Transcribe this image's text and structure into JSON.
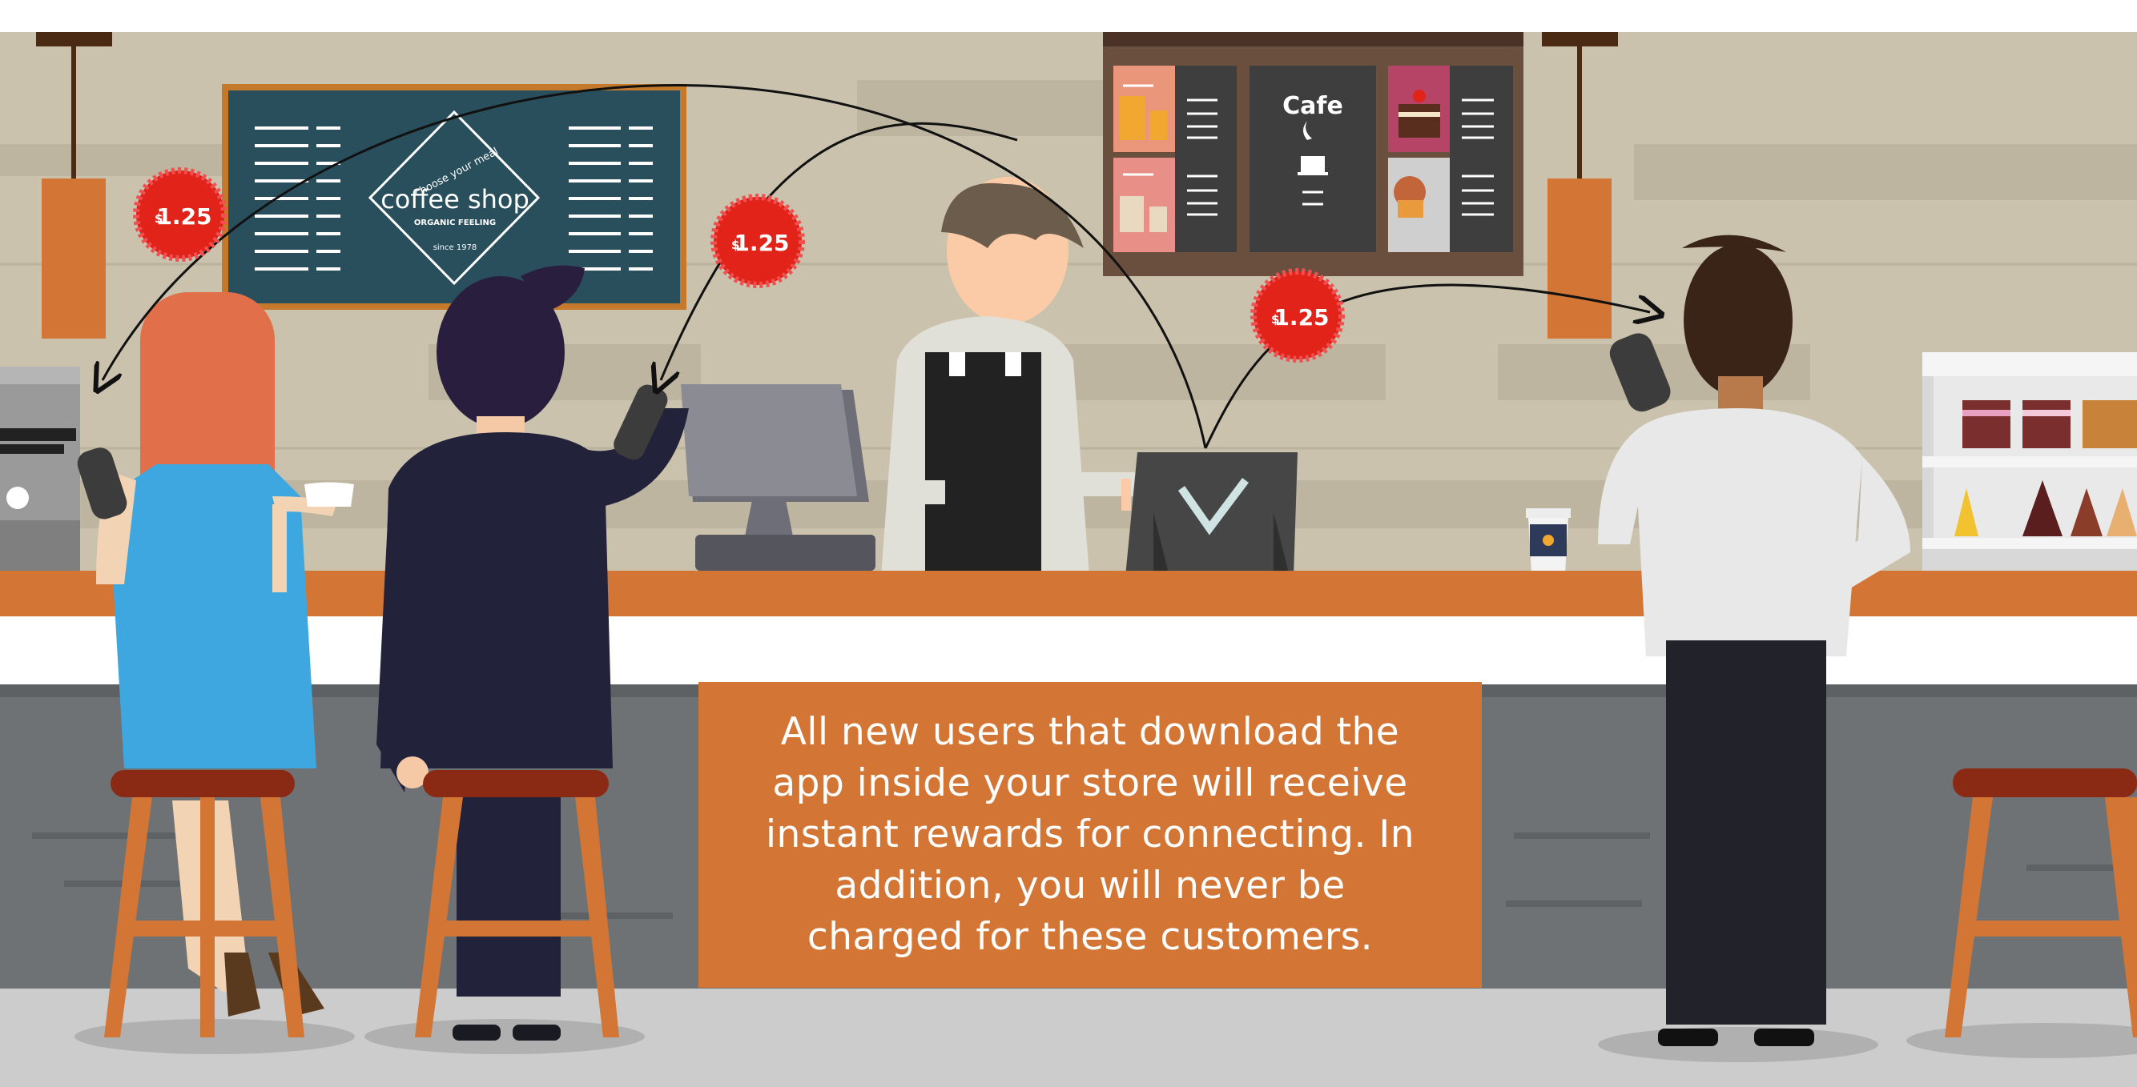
{
  "chalkboard": {
    "tagline": "choose your meal",
    "title": "coffee shop",
    "subtitle": "ORGANIC FEELING",
    "since": "since 1978"
  },
  "menu_board": {
    "center_title": "Cafe"
  },
  "price_badges": [
    {
      "currency": "$",
      "amount": "1.25"
    },
    {
      "currency": "$",
      "amount": "1.25"
    },
    {
      "currency": "$",
      "amount": "1.25"
    }
  ],
  "caption": {
    "lines": [
      "All new users that download the",
      "app inside your store will receive",
      "instant rewards for connecting. In",
      "addition, you will never be",
      "charged for these customers."
    ]
  },
  "colors": {
    "wall": "#CAC2AD",
    "counter_top": "#D37534",
    "counter_front": "#6F7274",
    "floor": "#CCCCCC",
    "chalkboard": "#2A4F5C",
    "badge": "#E2231A",
    "accent_orange": "#D37534"
  }
}
